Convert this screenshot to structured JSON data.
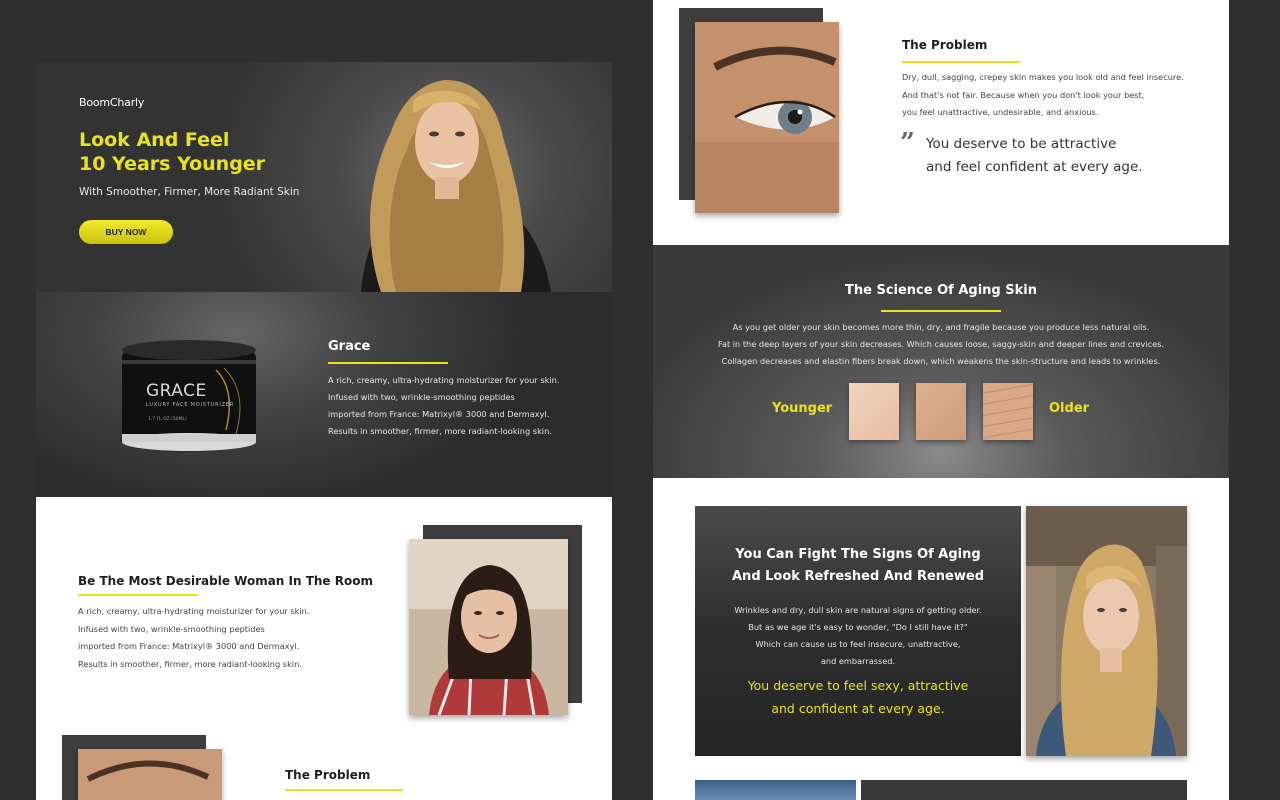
{
  "hero": {
    "logo": "BoomCharly",
    "title_line1": "Look And Feel",
    "title_line2": "10 Years Younger",
    "subtitle": "With Smoother, Firmer, More Radiant Skin",
    "buy_label": "BUY NOW"
  },
  "product": {
    "jar_brand": "GRACE",
    "jar_caption": "LUXURY FACE MOISTURIZER",
    "jar_size": "1.7 FL OZ (50ML)",
    "title": "Grace",
    "lines": [
      "A rich, creamy, ultra-hydrating moisturizer for your skin.",
      "Infused with two, wrinkle-smoothing peptides",
      "imported from France: Matrixyl® 3000 and Dermaxyl.",
      "Results in smoother, firmer, more radiant-looking skin."
    ]
  },
  "desirable": {
    "title": "Be The Most Desirable Woman In The Room",
    "lines": [
      "A rich, creamy, ultra-hydrating moisturizer for your skin.",
      "Infused with two, wrinkle-smoothing peptides",
      "imported from France: Matrixyl® 3000 and Dermaxyl.",
      "Results in smoother, firmer, more radiant-looking skin."
    ]
  },
  "problem": {
    "title": "The Problem",
    "lines": [
      "Dry, dull, sagging, crepey skin makes you look old and feel insecure.",
      "And that's not fair. Because when you don't look your best,",
      "you feel unattractive, undesirable, and anxious."
    ],
    "quote_line1": "You deserve to be attractive",
    "quote_line2": "and feel confident at every age."
  },
  "science": {
    "title": "The Science Of Aging Skin",
    "lines": [
      "As you get older your skin becomes more thin, dry, and fragile because you produce less natural oils.",
      "Fat in the deep layers of your skin decreases. Which causes loose, saggy-skin and deeper lines and crevices.",
      "Collagen decreases and elastin fibers break down, which weakens the skin-structure and leads to wrinkles."
    ],
    "younger": "Younger",
    "older": "Older"
  },
  "fight": {
    "title_line1": "You Can Fight The Signs Of Aging",
    "title_line2": "And Look Refreshed And Renewed",
    "lines": [
      "Wrinkles and dry, dull skin are natural signs of getting older.",
      "But as we age it's easy to wonder, \"Do I still have it?\"",
      "Which can cause us to feel insecure, unattractive,",
      "and embarrassed."
    ],
    "highlight_line1": "You deserve to feel sexy, attractive",
    "highlight_line2": "and confident at every age."
  },
  "colors": {
    "accent_yellow": "#e9e31a",
    "dark_bg": "#2f2f2f"
  }
}
